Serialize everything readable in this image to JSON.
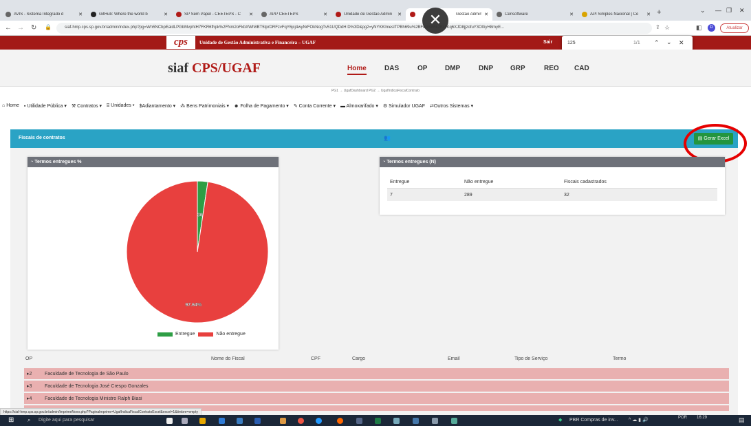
{
  "browser": {
    "tabs": [
      {
        "label": "AVIS - Sistema Integrado d",
        "icon": "globe-icon"
      },
      {
        "label": "GitHub: Where the world b",
        "icon": "github-icon"
      },
      {
        "label": "SP Sem Papel - CEETEPS - C",
        "icon": "sp-icon"
      },
      {
        "label": "APP CEETEPS",
        "icon": "globe-icon"
      },
      {
        "label": "Unidade de Gestão Admin",
        "icon": "sp-icon"
      },
      {
        "label": "Gestão Admin",
        "icon": "sp-icon"
      },
      {
        "label": "Censoftware",
        "icon": "globe-icon"
      },
      {
        "label": "API Simples Nacional | Co",
        "icon": "api-icon"
      }
    ],
    "new_tab": "+",
    "url": "siaf-hmp.cps.sp.gov.br/admin/index.php?pg=Wn5NCbpEaldLPGbMvphtH7FKR6fhpk%2FNm2oFkbXWh8BT5tprDRFzvFqY6jcj4wyNrFOkNogTv51UQDdH      D%3D&pg2=yNYKKlmesITPBh69u%2BFBpSih%2BUiKq6XJD8jjzofuY3O0iyH8myE...",
    "update_label": "Atualizar",
    "profile_letter": "D"
  },
  "header": {
    "logo_text": "cps",
    "title": "Unidade de Gestão Administrativa e Financeira – UGAF",
    "sair": "Sair"
  },
  "find_bar": {
    "query": "125",
    "count": "1/1"
  },
  "site": {
    "logo_prefix": "siaf ",
    "logo_main": "CPS/UGAF",
    "nav": [
      "Home",
      "DAS",
      "OP",
      "DMP",
      "DNP",
      "GRP",
      "REO",
      "CAD"
    ],
    "breadcrumb": "PG1 → UgafDashboard PG2 → UgafIndicaFiscalContrato"
  },
  "menu": [
    {
      "label": "Home",
      "icon": "home-icon"
    },
    {
      "label": "Utilidade Pública",
      "icon": "file-icon",
      "caret": true
    },
    {
      "label": "Contratos",
      "icon": "gavel-icon",
      "caret": true
    },
    {
      "label": "Unidades",
      "icon": "building-icon",
      "caret": true
    },
    {
      "label": "Adiantamento",
      "icon": "dollar-icon",
      "caret": true
    },
    {
      "label": "Bens Patrimoniais",
      "icon": "cubes-icon",
      "caret": true
    },
    {
      "label": "Folha de Pagamento",
      "icon": "users-icon",
      "caret": true
    },
    {
      "label": "Conta Corrente",
      "icon": "pen-icon",
      "caret": true
    },
    {
      "label": "Almoxarifado",
      "icon": "box-icon",
      "caret": true
    },
    {
      "label": "Simulador UGAF",
      "icon": "gear-icon"
    },
    {
      "label": "Outros Sistemas",
      "icon": "exchange-icon",
      "caret": true
    }
  ],
  "panel": {
    "title": "Fiscais de contratos",
    "excel_button": "Gerar Excel"
  },
  "pie_card": {
    "title": "Termos entregues %",
    "legend": [
      "Entregue",
      "Não entregue"
    ]
  },
  "chart_data": {
    "type": "pie",
    "categories": [
      "Entregue",
      "Não entregue"
    ],
    "values": [
      2.36,
      97.64
    ],
    "labels": [
      "2.36%",
      "97.64%"
    ],
    "colors": [
      "#2e9e45",
      "#e8403e"
    ]
  },
  "count_card": {
    "title": "Termos entregues (N)",
    "headers": [
      "Entregue",
      "Não entregue",
      "Fiscais cadastrados"
    ],
    "values": [
      "7",
      "289",
      "32"
    ]
  },
  "fiscal_table": {
    "headers": [
      "OP",
      "Nome do Fiscal",
      "CPF",
      "Cargo",
      "Email",
      "Tipo de Serviço",
      "Termo"
    ],
    "rows": [
      {
        "op": "2",
        "nome": "Faculdade de Tecnologia de São Paulo"
      },
      {
        "op": "3",
        "nome": "Faculdade de Tecnologia José Crespo Gonzales"
      },
      {
        "op": "4",
        "nome": "Faculdade de Tecnologia Ministro Ralph Biasi"
      }
    ]
  },
  "status_url": "https://siaf-hmp.cps.sp.gov.br/admin/ImprimeNovo.php?PaginaImprime=UgafIndicaFiscalContratoExcel&excel=1&timbre=empty",
  "taskbar": {
    "search_placeholder": "Digite aqui para pesquisar",
    "news": "PBR Compras de inv...",
    "lang": "POR",
    "time": "16:29"
  }
}
